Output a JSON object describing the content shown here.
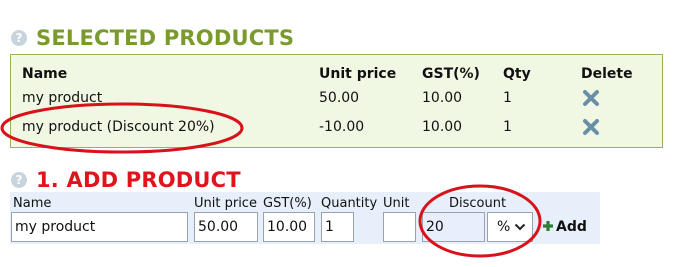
{
  "help_icon_glyph": "?",
  "selected": {
    "title": "SELECTED PRODUCTS",
    "columns": [
      "Name",
      "Unit price",
      "GST(%)",
      "Qty",
      "Delete"
    ],
    "rows": [
      {
        "name": "my product",
        "unit_price": "50.00",
        "gst": "10.00",
        "qty": "1"
      },
      {
        "name": "my product (Discount 20%)",
        "unit_price": "-10.00",
        "gst": "10.00",
        "qty": "1"
      }
    ]
  },
  "add": {
    "title": "1. ADD PRODUCT",
    "labels": {
      "name": "Name",
      "unit_price": "Unit price",
      "gst": "GST(%)",
      "quantity": "Quantity",
      "unit": "Unit",
      "discount": "Discount"
    },
    "values": {
      "name": "my product",
      "unit_price": "50.00",
      "gst": "10.00",
      "quantity": "1",
      "unit": "",
      "discount": "20",
      "discount_type": "%"
    },
    "button_label": "Add"
  },
  "colors": {
    "selected_title": "#7a9a2c",
    "add_title": "#e0141c",
    "panel_bg": "#f0f8e4",
    "panel_border": "#97b35a",
    "delete_icon": "#6c8fa8",
    "annotation_ring": "#d8121a",
    "add_icon": "#2e7d32"
  }
}
